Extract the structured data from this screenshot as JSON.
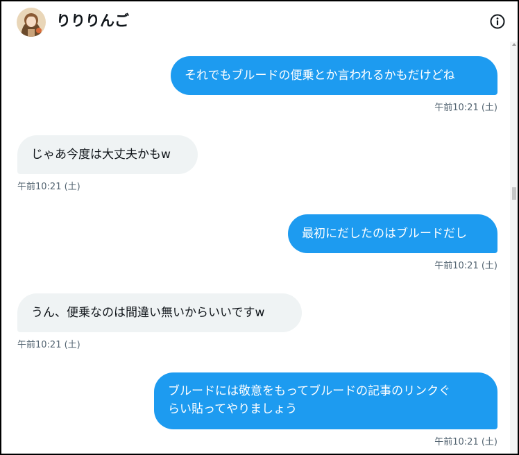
{
  "header": {
    "name": "りりりんご",
    "info_icon": "info-circle-icon",
    "avatar_icon": "user-avatar"
  },
  "messages": [
    {
      "direction": "out",
      "text": "それでもブルードの便乗とか言われるかもだけどね",
      "time": "午前10:21 (土)"
    },
    {
      "direction": "in",
      "text": "じゃあ今度は大丈夫かもw",
      "time": "午前10:21 (土)"
    },
    {
      "direction": "out",
      "text": "最初にだしたのはブルードだし",
      "time": "午前10:21 (土)"
    },
    {
      "direction": "in",
      "text": "うん、便乗なのは間違い無いからいいですw",
      "time": "午前10:21 (土)"
    },
    {
      "direction": "out",
      "lines": [
        "ブルードには敬意をもってブルードの記事のリンクぐ",
        "らい貼ってやりましょう"
      ],
      "time": "午前10:21 (土)"
    }
  ],
  "colors": {
    "outgoing_bubble": "#1d9bf0",
    "incoming_bubble": "#eff3f4",
    "timestamp": "#536471"
  }
}
